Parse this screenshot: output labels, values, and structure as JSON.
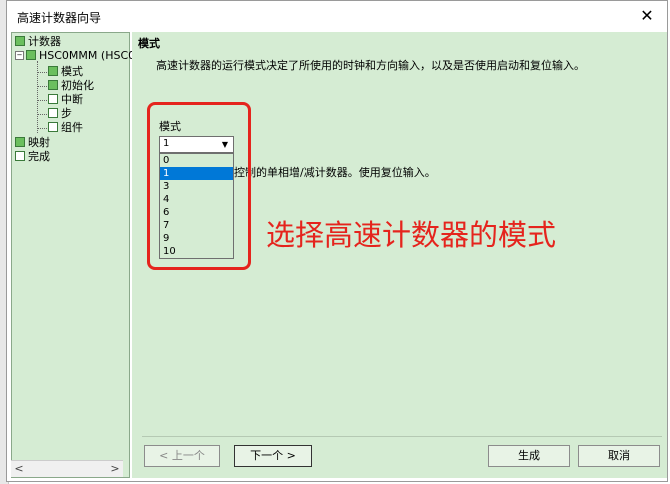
{
  "window": {
    "title": "高速计数器向导",
    "close_symbol": "✕"
  },
  "tree": {
    "items": [
      {
        "label": "计数器"
      },
      {
        "label": "HSC0MMM (HSC0"
      },
      {
        "label": "模式"
      },
      {
        "label": "初始化"
      },
      {
        "label": "中断"
      },
      {
        "label": "步"
      },
      {
        "label": "组件"
      },
      {
        "label": "映射"
      },
      {
        "label": "完成"
      }
    ],
    "expander_symbol": "−",
    "scroll_left": "<",
    "scroll_right": ">"
  },
  "main": {
    "section_title": "模式",
    "description": "高速计数器的运行模式决定了所使用的时钟和方向输入，以及是否使用启动和复位输入。",
    "mode_label": "模式",
    "mode_selected": "1",
    "dropdown_arrow": "▼",
    "mode_options": [
      "0",
      "1",
      "3",
      "4",
      "6",
      "7",
      "9",
      "10"
    ],
    "partial_description": "控制的单相增/减计数器。使用复位输入。",
    "annotation": "选择高速计数器的模式"
  },
  "buttons": {
    "prev": "< 上一个",
    "next": "下一个 >",
    "generate": "生成",
    "cancel": "取消"
  },
  "colors": {
    "panel_bg": "#d5ecd3",
    "annotation_red": "#e5241d",
    "selection_blue": "#0078d7"
  }
}
